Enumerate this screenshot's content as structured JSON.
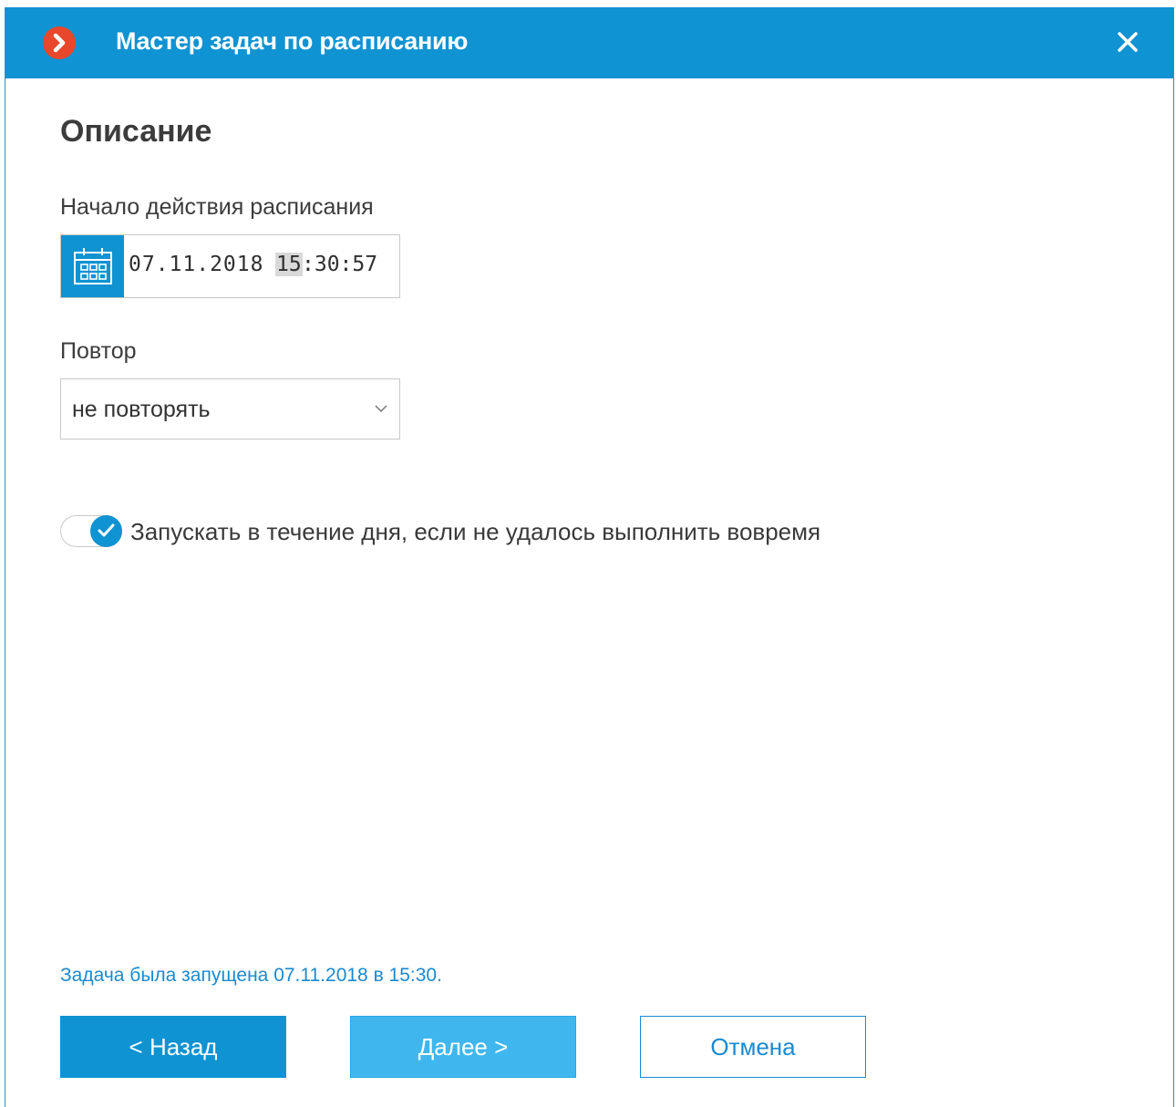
{
  "window": {
    "title": "Мастер задач по расписанию",
    "accent_color": "#0f93d2",
    "logo_color": "#e8472b"
  },
  "page": {
    "section_title": "Описание"
  },
  "schedule_start": {
    "label": "Начало действия расписания",
    "date": "07.11.2018",
    "hour": "15",
    "time_rest": ":30:57",
    "calendar_icon": "calendar-icon"
  },
  "repeat": {
    "label": "Повтор",
    "selected": "не повторять"
  },
  "run_missed": {
    "label": "Запускать в течение дня, если не удалось выполнить вовремя",
    "checked": true
  },
  "status": {
    "text": "Задача была запущена 07.11.2018 в 15:30."
  },
  "buttons": {
    "back": "< Назад",
    "next": "Далее >",
    "cancel": "Отмена"
  }
}
